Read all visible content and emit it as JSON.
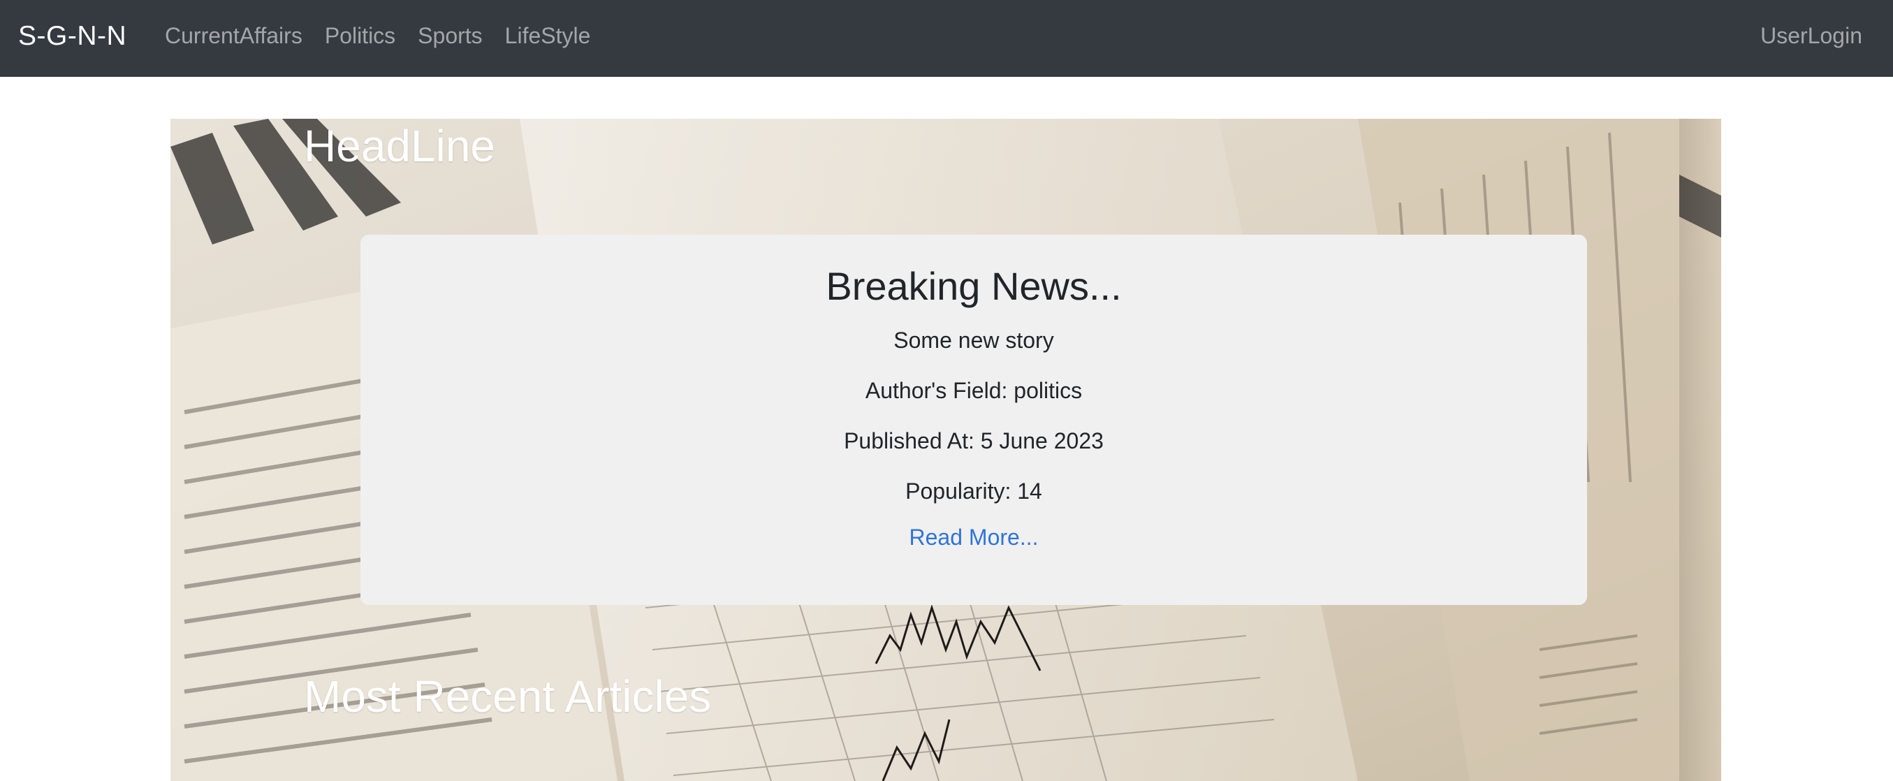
{
  "navbar": {
    "brand": "S-G-N-N",
    "links": [
      "CurrentAffairs",
      "Politics",
      "Sports",
      "LifeStyle"
    ],
    "user_login": "UserLogin",
    "background": "#343a40"
  },
  "hero": {
    "headline_title": "HeadLine",
    "recent_title": "Most Recent Articles",
    "background_image": "newspaper-and-stock-chart-photo"
  },
  "breaking": {
    "title": "Breaking News...",
    "story": "Some new story",
    "author_field": "Author's Field: politics",
    "published_at": "Published At: 5 June 2023",
    "popularity": "Popularity: 14",
    "read_more": "Read More...",
    "link_color": "#2f74d8"
  }
}
